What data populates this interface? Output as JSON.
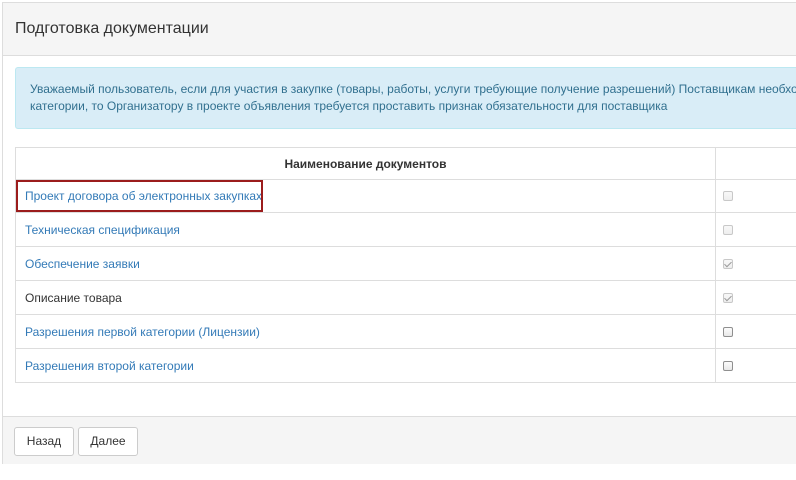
{
  "panel": {
    "title": "Подготовка документации"
  },
  "alert": {
    "line1": "Уважаемый пользователь, если для участия в закупке (товары, работы, услуги требующие получение разрешений) Поставщикам необходимо",
    "line2": "категории, то Организатору в проекте объявления требуется проставить признак обязательности для поставщика"
  },
  "table": {
    "header_name": "Наименование документов",
    "header_check": "",
    "rows": [
      {
        "name": "Проект договора об электронных закупках",
        "link": true,
        "checked": false,
        "disabled": true
      },
      {
        "name": "Техническая спецификация",
        "link": true,
        "checked": false,
        "disabled": true
      },
      {
        "name": "Обеспечение заявки",
        "link": true,
        "checked": true,
        "disabled": true
      },
      {
        "name": "Описание товара",
        "link": false,
        "checked": true,
        "disabled": true
      },
      {
        "name": "Разрешения первой категории (Лицензии)",
        "link": true,
        "checked": false,
        "disabled": false
      },
      {
        "name": "Разрешения второй категории",
        "link": true,
        "checked": false,
        "disabled": false
      }
    ]
  },
  "footer": {
    "back_label": "Назад",
    "next_label": "Далее"
  },
  "colors": {
    "link": "#337ab7",
    "alert_bg": "#d9edf7",
    "alert_text": "#31708f",
    "highlight": "#9b1c1c"
  }
}
